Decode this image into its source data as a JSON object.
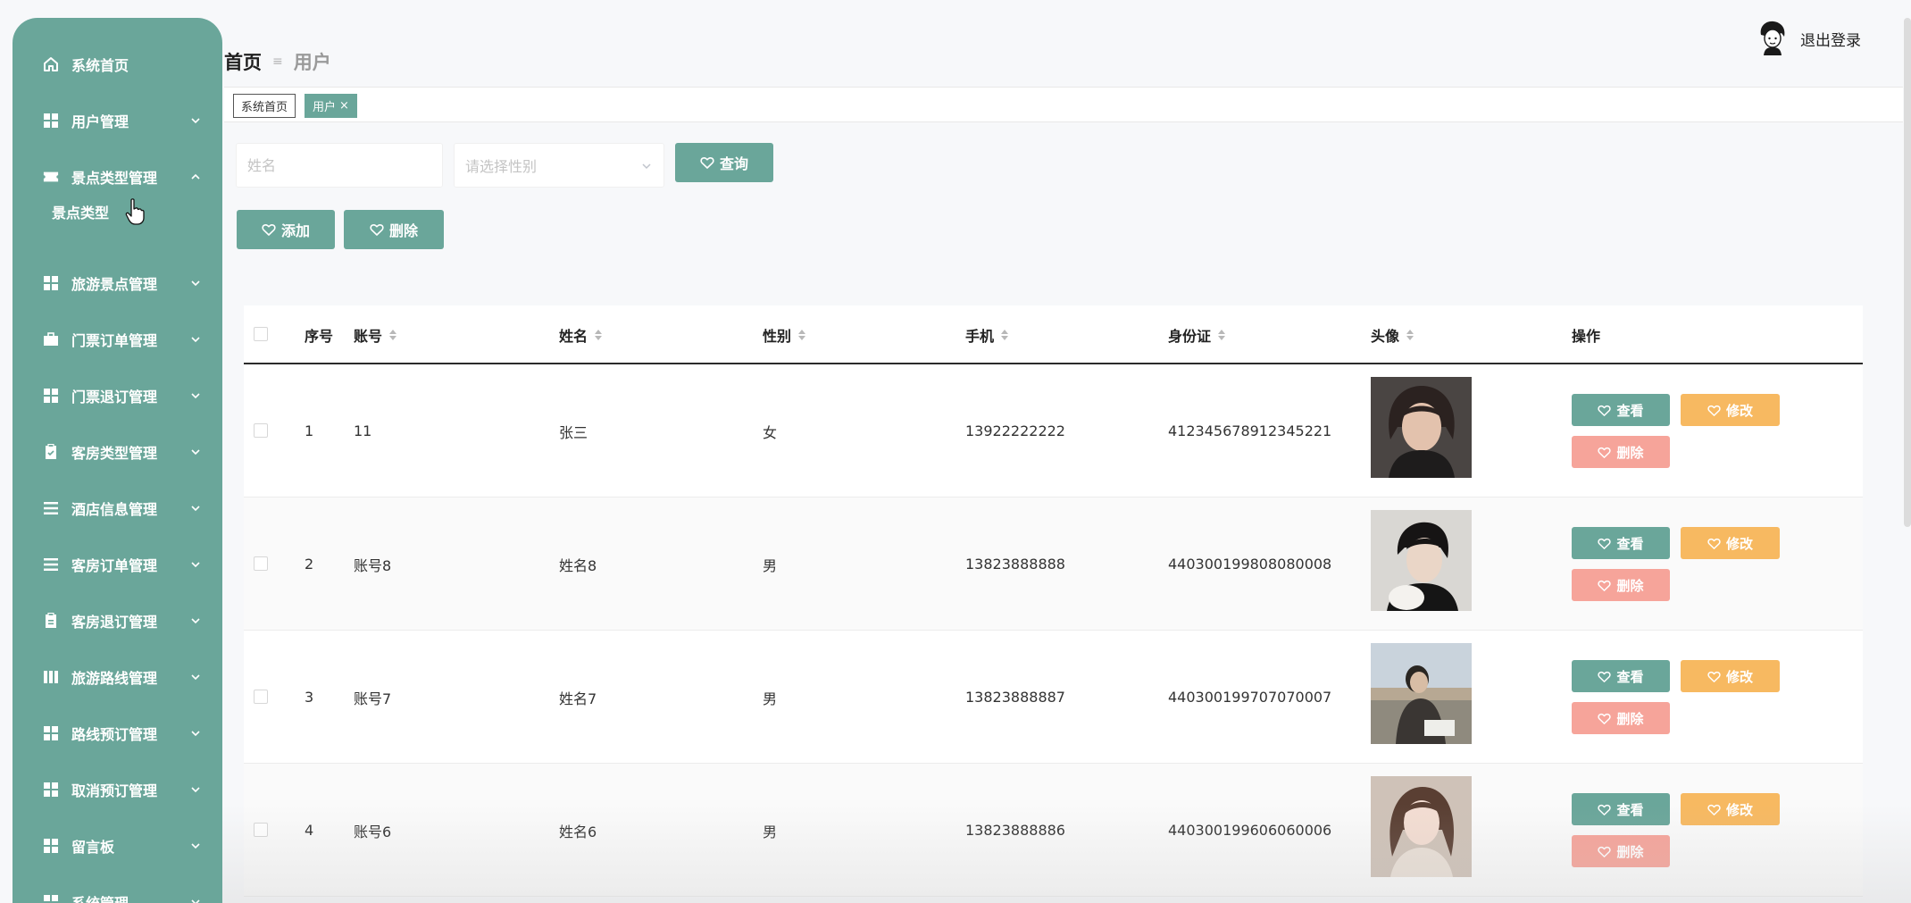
{
  "sidebar": {
    "bg_color": "#6aa69a",
    "items": [
      {
        "label": "系统首页",
        "icon": "home-icon",
        "arrow": false
      },
      {
        "label": "用户管理",
        "icon": "grid-icon",
        "arrow": "down"
      },
      {
        "label": "景点类型管理",
        "icon": "ticket-icon",
        "arrow": "up",
        "expanded": true
      },
      {
        "label": "旅游景点管理",
        "icon": "grid-icon",
        "arrow": "down"
      },
      {
        "label": "门票订单管理",
        "icon": "briefcase-icon",
        "arrow": "down"
      },
      {
        "label": "门票退订管理",
        "icon": "grid-icon",
        "arrow": "down"
      },
      {
        "label": "客房类型管理",
        "icon": "clipboard-icon",
        "arrow": "down"
      },
      {
        "label": "酒店信息管理",
        "icon": "list-icon",
        "arrow": "down"
      },
      {
        "label": "客房订单管理",
        "icon": "list-icon",
        "arrow": "down"
      },
      {
        "label": "客房退订管理",
        "icon": "clipboard-icon",
        "arrow": "down"
      },
      {
        "label": "旅游路线管理",
        "icon": "book-icon",
        "arrow": "down"
      },
      {
        "label": "路线预订管理",
        "icon": "grid-icon",
        "arrow": "down"
      },
      {
        "label": "取消预订管理",
        "icon": "grid-icon",
        "arrow": "down"
      },
      {
        "label": "留言板",
        "icon": "grid-icon",
        "arrow": "down"
      },
      {
        "label": "系统管理",
        "icon": "grid-icon",
        "arrow": "down"
      }
    ],
    "submenu": {
      "label": "景点类型"
    }
  },
  "header": {
    "breadcrumb_home": "首页",
    "breadcrumb_current": "用户",
    "logout_label": "退出登录"
  },
  "tabs": {
    "home": "系统首页",
    "current": "用户",
    "close": "×"
  },
  "search": {
    "name_placeholder": "姓名",
    "gender_placeholder": "请选择性别",
    "query_label": "查询"
  },
  "actions": {
    "add_label": "添加",
    "delete_label": "删除"
  },
  "table": {
    "columns": [
      "序号",
      "账号",
      "姓名",
      "性别",
      "手机",
      "身份证",
      "头像",
      "操作"
    ],
    "rows": [
      {
        "index": "1",
        "account": "11",
        "name": "张三",
        "gender": "女",
        "phone": "13922222222",
        "id_card": "412345678912345221",
        "avatar": "avatar-photo-1"
      },
      {
        "index": "2",
        "account": "账号8",
        "name": "姓名8",
        "gender": "男",
        "phone": "13823888888",
        "id_card": "440300199808080008",
        "avatar": "avatar-photo-2"
      },
      {
        "index": "3",
        "account": "账号7",
        "name": "姓名7",
        "gender": "男",
        "phone": "13823888887",
        "id_card": "440300199707070007",
        "avatar": "avatar-photo-3"
      },
      {
        "index": "4",
        "account": "账号6",
        "name": "姓名6",
        "gender": "男",
        "phone": "13823888886",
        "id_card": "440300199606060006",
        "avatar": "avatar-photo-4"
      }
    ],
    "row_actions": {
      "view": "查看",
      "edit": "修改",
      "delete": "删除"
    }
  },
  "colors": {
    "primary": "#6aa69a",
    "edit": "#f7b961",
    "danger": "#f6a49a"
  }
}
